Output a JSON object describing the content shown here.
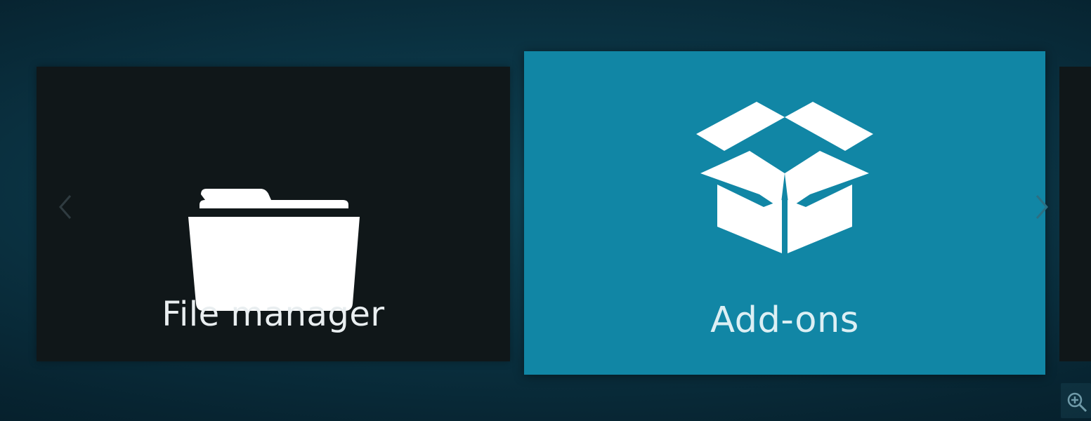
{
  "home_menu": {
    "tiles": [
      {
        "label": "File manager",
        "icon": "folder-icon",
        "focused": false
      },
      {
        "label": "Add-ons",
        "icon": "box-icon",
        "focused": true
      }
    ],
    "nav": {
      "prev_icon": "chevron-left-icon",
      "next_icon": "chevron-right-icon"
    },
    "zoom_icon": "zoom-in-icon"
  },
  "colors": {
    "background_dark": "#041620",
    "background_mid": "#0f4456",
    "tile_unfocused": "#101719",
    "tile_focused": "#1186a5",
    "text": "#e9eef0"
  }
}
